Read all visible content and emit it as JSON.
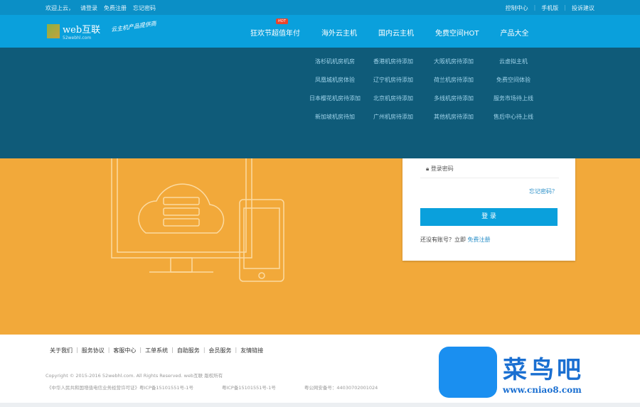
{
  "topbar": {
    "left": [
      "欢迎上云，",
      "请登录",
      "免费注册",
      "忘记密码"
    ],
    "right": [
      "控制中心",
      "手机版",
      "投诉建议"
    ]
  },
  "header": {
    "logo_text": "web互联",
    "logo_sub": "52webhl.com",
    "slogan": "云主机产品提供商"
  },
  "nav": {
    "items": [
      "狂欢节超值年付",
      "海外云主机",
      "国内云主机",
      "免费空间HOT",
      "产品大全"
    ],
    "hot_badge": "HOT"
  },
  "dropdown": {
    "items": [
      "洛杉矶机房机房",
      "香港机房待添加",
      "大阪机房待添加",
      "云虚拟主机",
      "凤凰城机房体验",
      "辽宁机房待添加",
      "荷兰机房待添加",
      "免费空间体验",
      "日本樱花机房待添加",
      "北京机房待添加",
      "多线机房待添加",
      "服务市场待上线",
      "新加坡机房待加",
      "广州机房待添加",
      "其他机房待添加",
      "售后中心待上线"
    ]
  },
  "login": {
    "password_placeholder": "登录密码",
    "forgot": "忘记密码？",
    "submit": "登 录",
    "no_account": "还没有账号？立即",
    "register": "免费注册"
  },
  "footer": {
    "links": [
      "关于我们",
      "服务协议",
      "客服中心",
      "工单系统",
      "自助服务",
      "会员服务",
      "友情链接"
    ],
    "copyright": "Copyright © 2015-2016 52webhl.com. All Rights Reserved. web互联 版权所有",
    "icp": [
      "《中华人民共和国增值电信业务经营许可证》粤ICP备15101551号-1号",
      "粤ICP备15101551号-1号",
      "粤公网安备号：44030702001024"
    ]
  },
  "watermark": {
    "text": "菜鸟吧",
    "url": "www.cniao8.com"
  },
  "colors": {
    "nav": "#0aa0dc",
    "overlay": "#0f5b79",
    "hero": "#f2a93a"
  }
}
